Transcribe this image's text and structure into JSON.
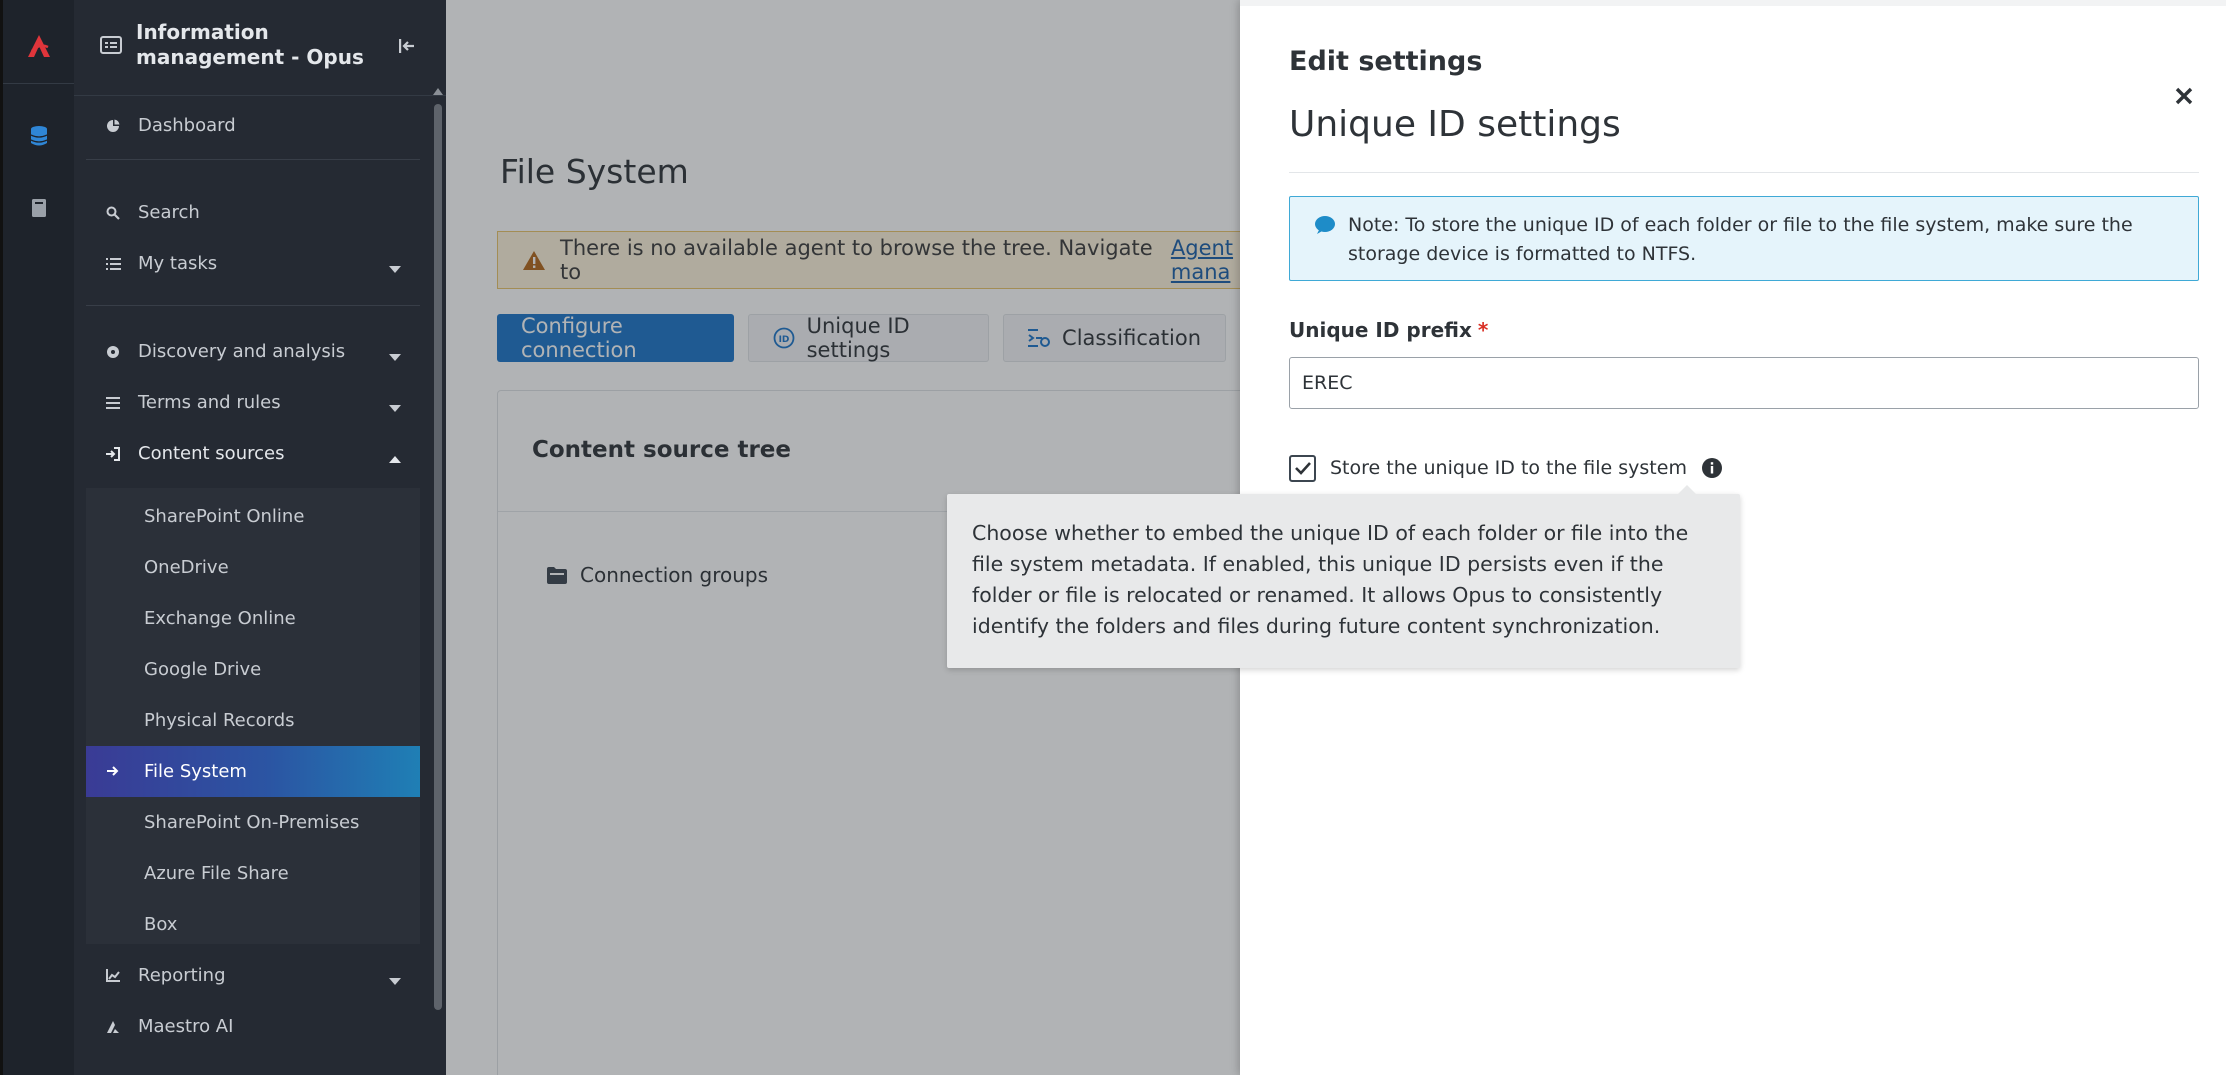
{
  "app": {
    "title": "Information management - Opus"
  },
  "sidebar": {
    "items": [
      {
        "label": "Dashboard"
      },
      {
        "label": "Search"
      },
      {
        "label": "My tasks"
      },
      {
        "label": "Discovery and analysis"
      },
      {
        "label": "Terms and rules"
      },
      {
        "label": "Content sources"
      },
      {
        "label": "Reporting"
      },
      {
        "label": "Maestro AI"
      }
    ],
    "content_sources": [
      {
        "label": "SharePoint Online"
      },
      {
        "label": "OneDrive"
      },
      {
        "label": "Exchange Online"
      },
      {
        "label": "Google Drive"
      },
      {
        "label": "Physical Records"
      },
      {
        "label": "File System"
      },
      {
        "label": "SharePoint On-Premises"
      },
      {
        "label": "Azure File Share"
      },
      {
        "label": "Box"
      }
    ]
  },
  "main": {
    "page_title": "File System",
    "warning_text": "There is no available agent to browse the tree. Navigate to",
    "warning_link": "Agent mana",
    "tabs": [
      {
        "label": "Configure connection"
      },
      {
        "label": "Unique ID settings"
      },
      {
        "label": "Classification"
      }
    ],
    "card_title": "Content source tree",
    "tree_node": "Connection groups"
  },
  "drawer": {
    "title": "Edit settings",
    "section_title": "Unique ID settings",
    "note": "Note: To store the unique ID of each folder or file to the file system, make sure the storage device is formatted to NTFS.",
    "prefix_label": "Unique ID prefix",
    "required_mark": "*",
    "prefix_value": "EREC",
    "store_label": "Store the unique ID to the file system",
    "store_checked": true
  },
  "tooltip": {
    "text": "Choose whether to embed the unique ID of each folder or file into the file system metadata. If enabled, this unique ID persists even if the folder or file is relocated or renamed. It allows Opus to consistently identify the folders and files during future content synchronization."
  },
  "colors": {
    "sidebar_bg": "#252a33",
    "rail_bg": "#1e232b",
    "primary": "#1b75c9",
    "active_gradient_start": "#3a3b95",
    "active_gradient_end": "#1f7fb5",
    "logo_red": "#e0353b",
    "note_bg": "#e5f4fb",
    "note_border": "#3fa9d6",
    "warning_bg": "#fdf3dc",
    "required": "#d93025"
  }
}
